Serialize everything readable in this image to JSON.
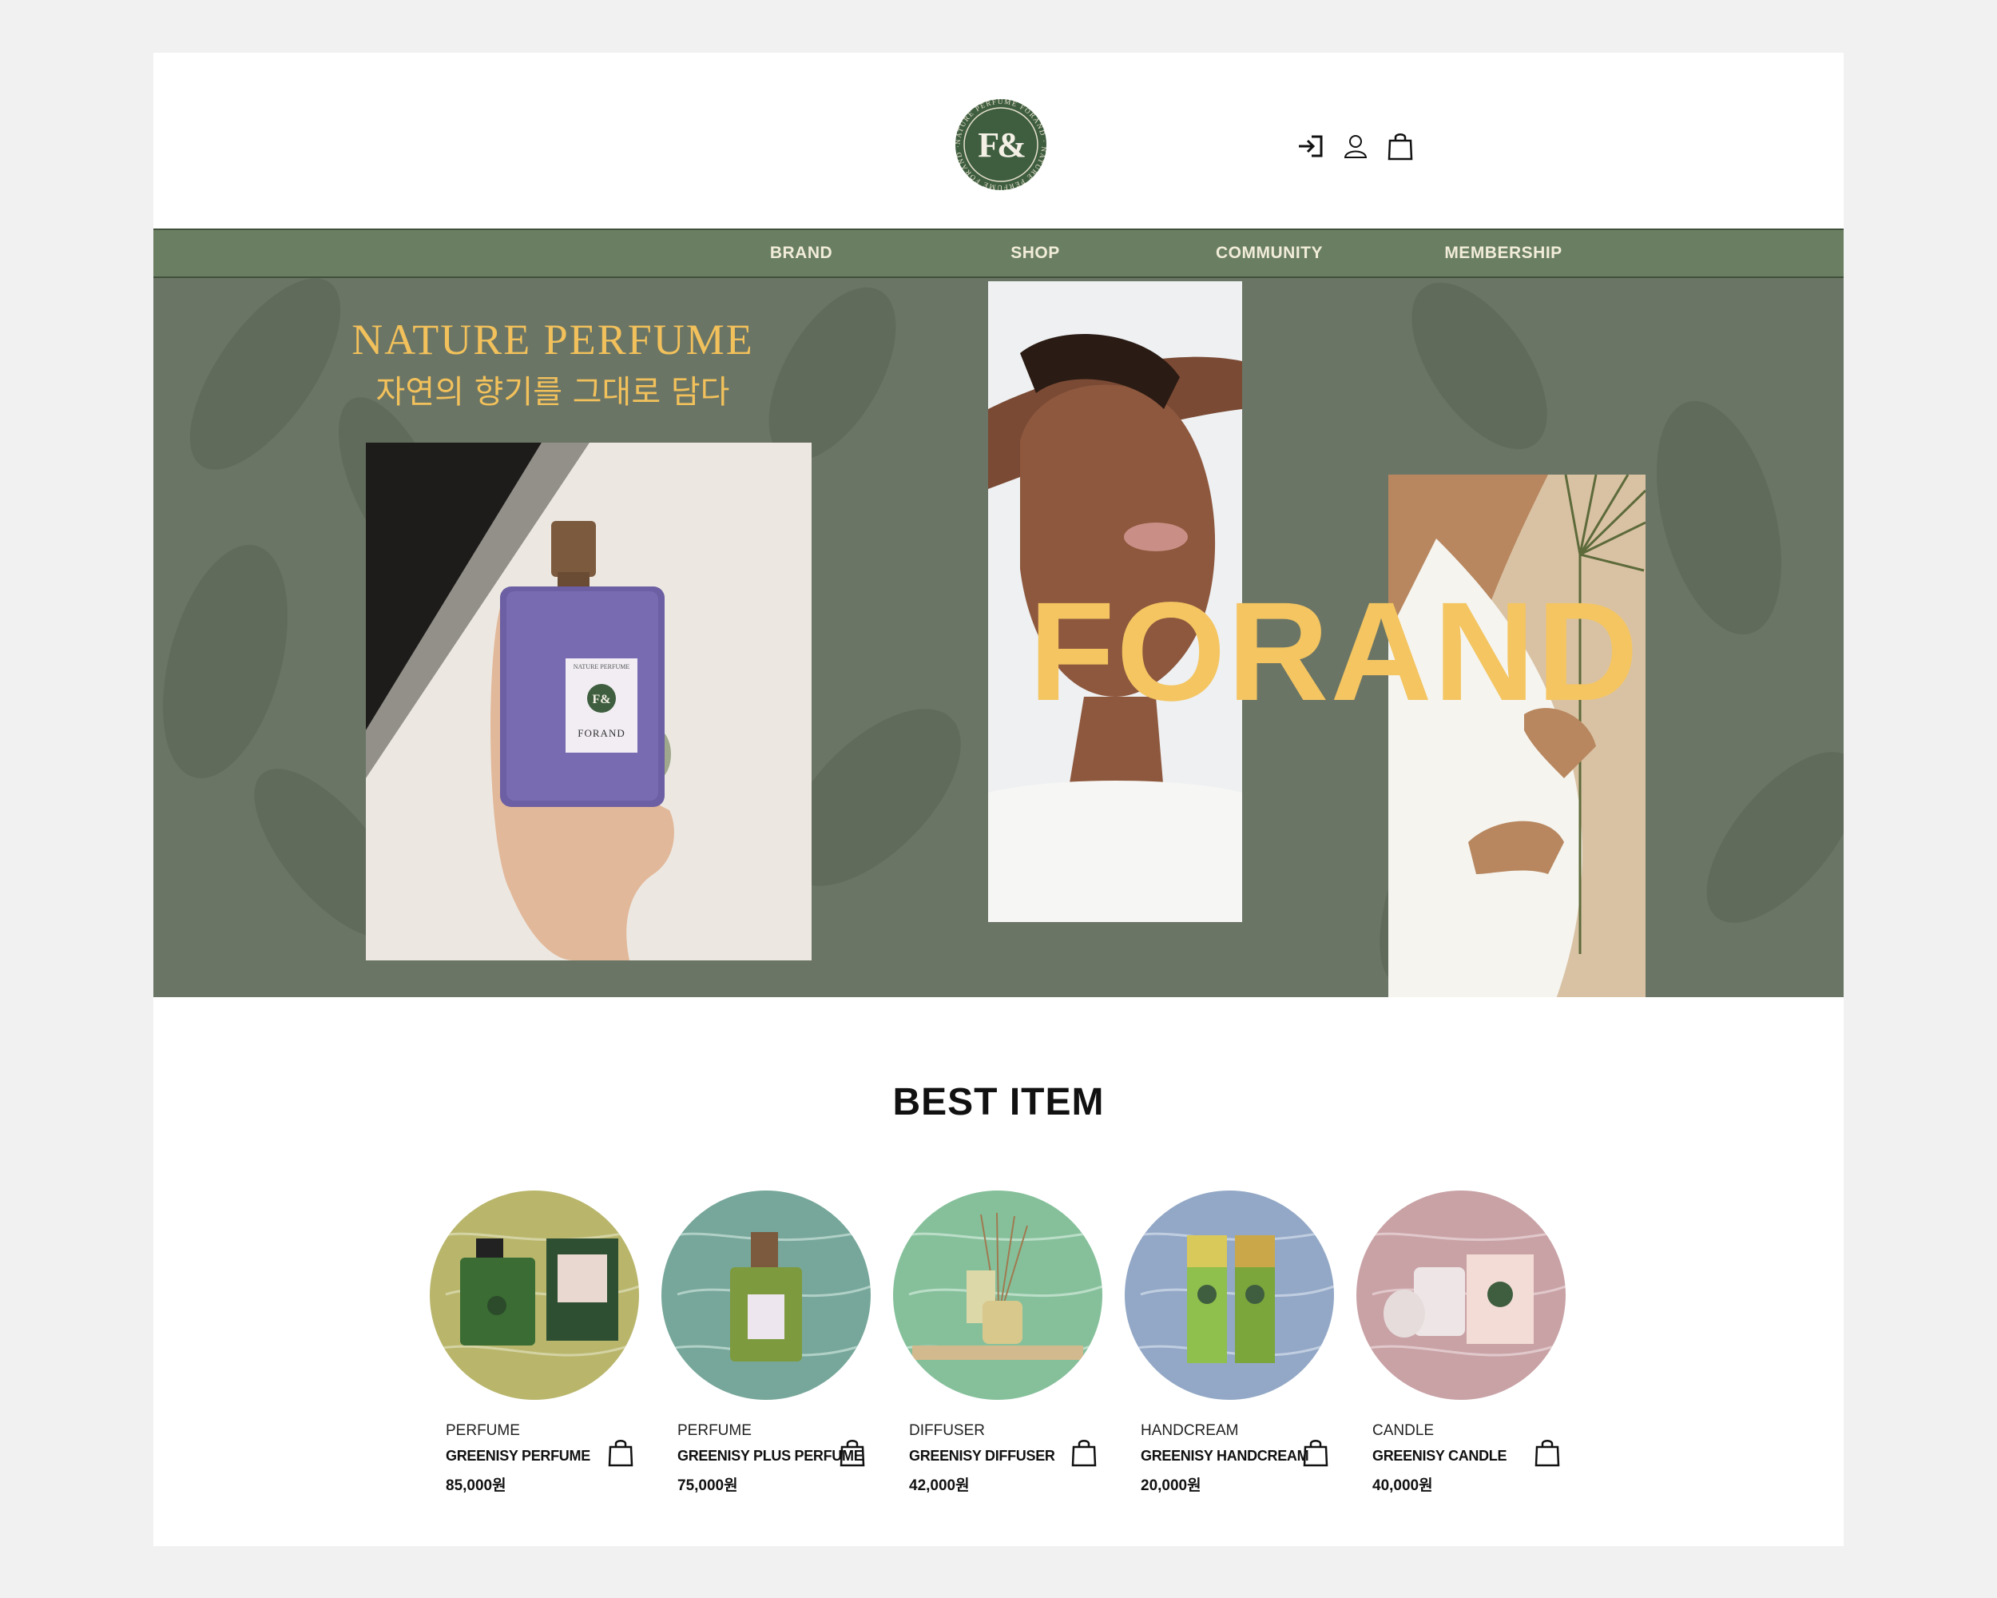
{
  "header": {
    "logo": {
      "monogram": "F&",
      "ring_text": "NATURE PERFUME FORAND",
      "color": "#3f5e3f"
    },
    "icons": [
      "login-icon",
      "user-icon",
      "shopping-bag-icon"
    ]
  },
  "nav": {
    "items": [
      {
        "label": "BRAND"
      },
      {
        "label": "SHOP"
      },
      {
        "label": "COMMUNITY"
      },
      {
        "label": "MEMBERSHIP"
      }
    ],
    "background": "#6a7f62"
  },
  "hero": {
    "title": "NATURE PERFUME",
    "subtitle": "자연의 향기를 그대로 담다",
    "brand": "FORAND",
    "bottle_label": "FORAND",
    "bottle_label_small": "NATURE PERFUME",
    "accent": "#f2c15b",
    "background": "#6b7565"
  },
  "best": {
    "title": "BEST ITEM",
    "products": [
      {
        "category": "PERFUME",
        "name": "GREENISY PERFUME",
        "price": "85,000원",
        "bg": "#b9b66c"
      },
      {
        "category": "PERFUME",
        "name": "GREENISY PLUS PERFUME",
        "price": "75,000원",
        "bg": "#77a79a"
      },
      {
        "category": "DIFFUSER",
        "name": "GREENISY DIFFUSER",
        "price": "42,000원",
        "bg": "#86c09b"
      },
      {
        "category": "HANDCREAM",
        "name": "GREENISY HANDCREAM",
        "price": "20,000원",
        "bg": "#93a8c6"
      },
      {
        "category": "CANDLE",
        "name": "GREENISY CANDLE",
        "price": "40,000원",
        "bg": "#c9a2a6"
      }
    ]
  }
}
